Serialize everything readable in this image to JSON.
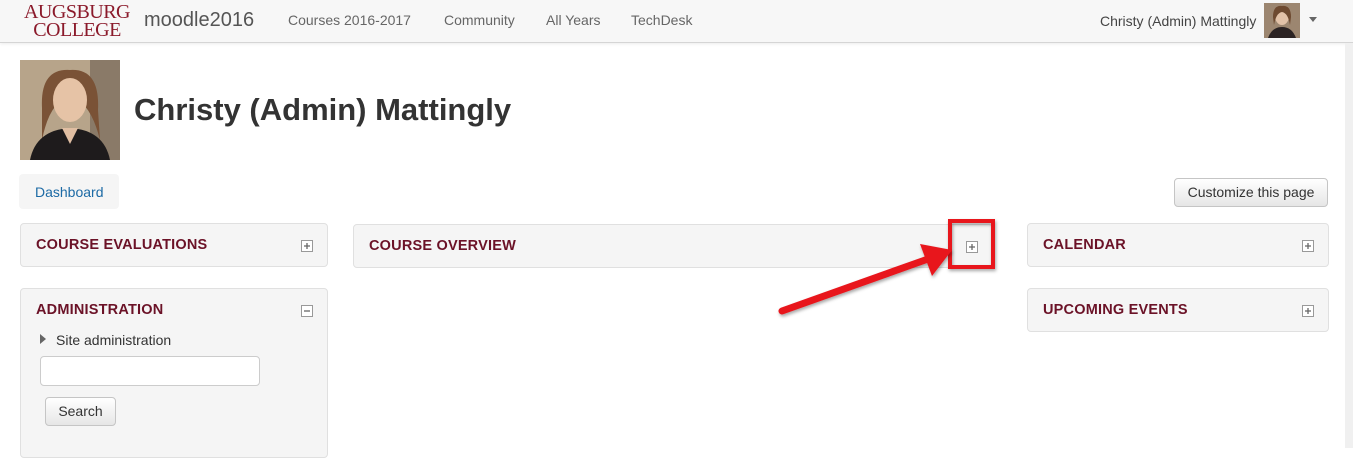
{
  "navbar": {
    "logo_line1": "AUGSBURG",
    "logo_line2": "COLLEGE",
    "site_name": "moodle2016",
    "links": [
      "Courses 2016-2017",
      "Community",
      "All Years",
      "TechDesk"
    ],
    "user_name": "Christy (Admin) Mattingly",
    "user_avatar_icon": "user-avatar"
  },
  "profile": {
    "name": "Christy (Admin) Mattingly",
    "picture_icon": "profile-picture"
  },
  "breadcrumb": {
    "label": "Dashboard"
  },
  "buttons": {
    "customize": "Customize this page",
    "search": "Search"
  },
  "blocks": {
    "course_evaluations": "COURSE EVALUATIONS",
    "course_overview": "COURSE OVERVIEW",
    "calendar": "CALENDAR",
    "upcoming_events": "UPCOMING EVENTS",
    "administration": "ADMINISTRATION",
    "site_administration": "Site administration"
  },
  "search": {
    "value": "",
    "placeholder": ""
  },
  "colors": {
    "brand": "#8b1a2b",
    "block_title": "#6b1227",
    "link": "#1c6aa5",
    "annotation": "#e8141c"
  }
}
